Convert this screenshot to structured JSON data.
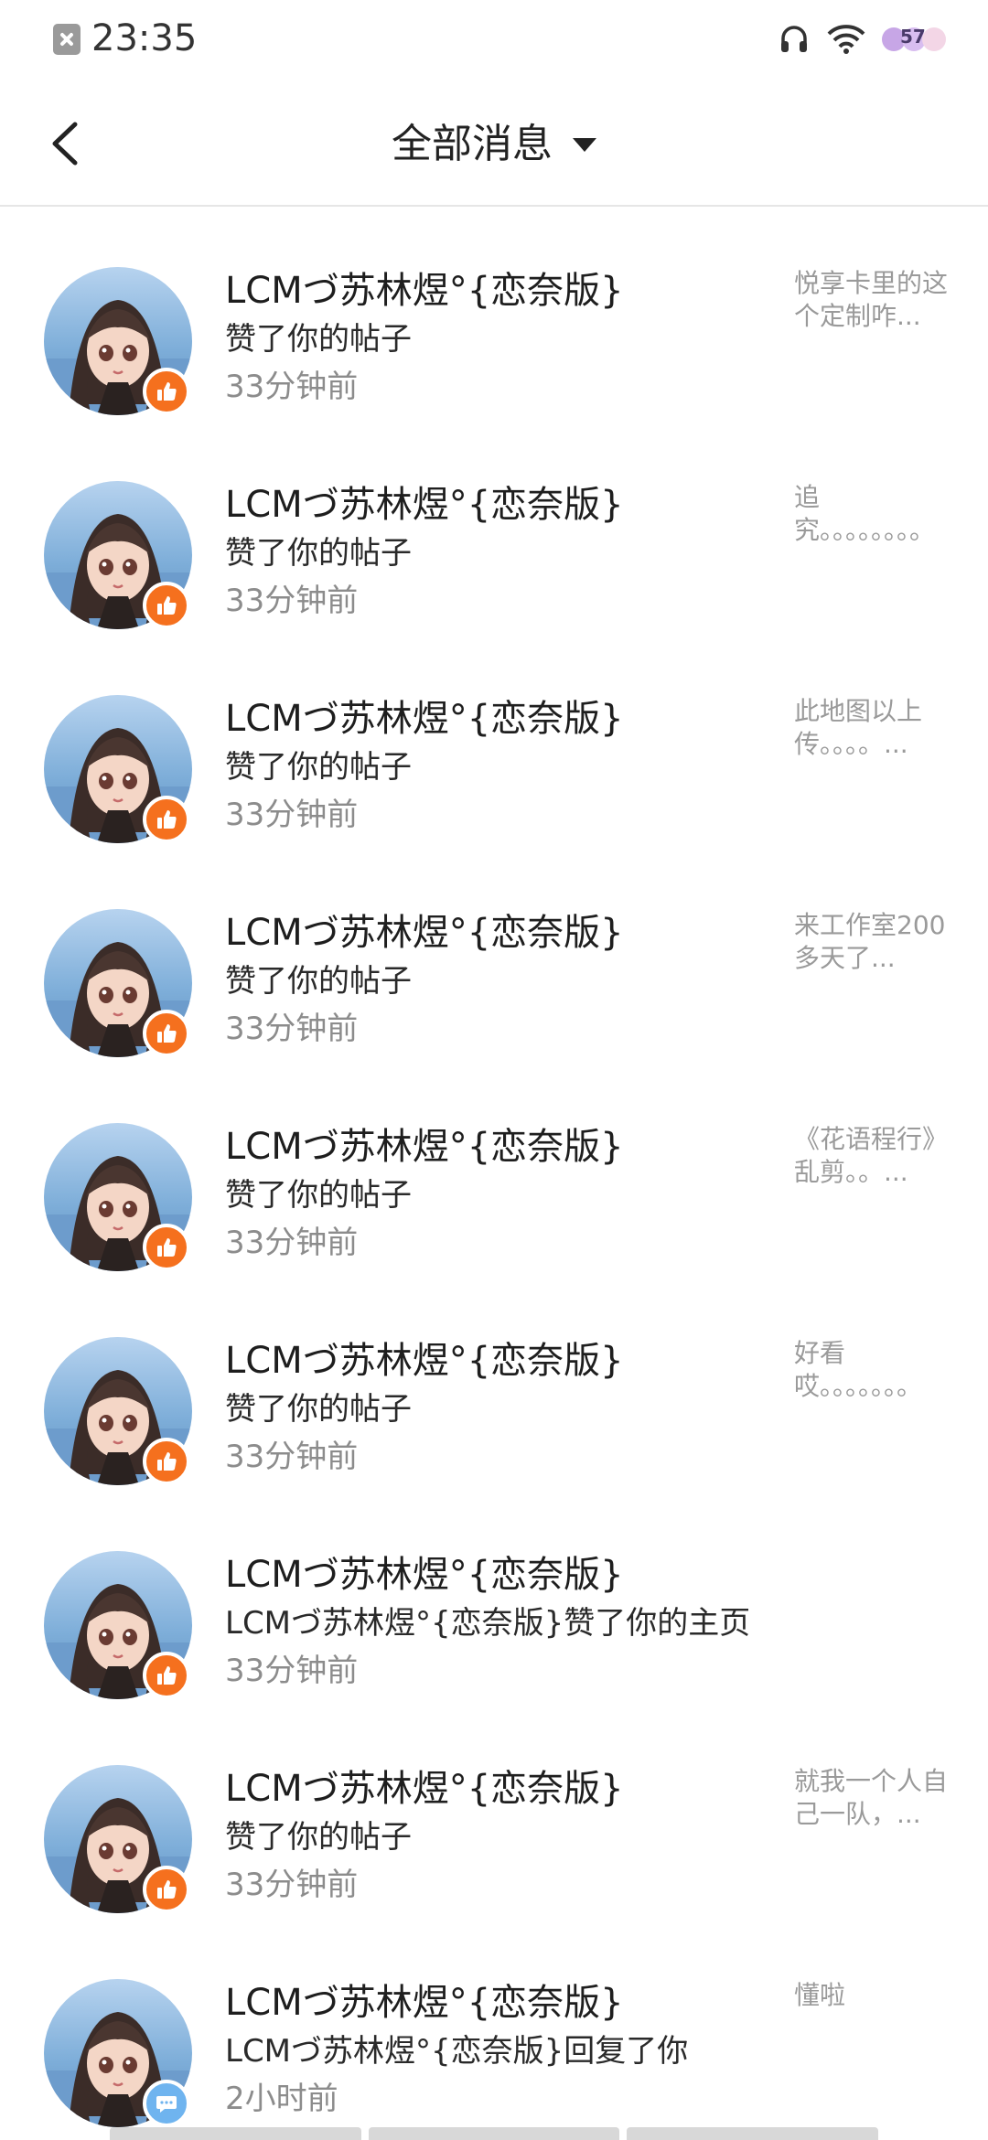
{
  "status_bar": {
    "time": "23:35",
    "battery": "57"
  },
  "header": {
    "title": "全部消息"
  },
  "messages": [
    {
      "name": "LCMづ苏林煜°{恋奈版}",
      "action": "赞了你的帖子",
      "time": "33分钟前",
      "preview": "悦享卡里的这个定制咋...",
      "type": "like"
    },
    {
      "name": "LCMづ苏林煜°{恋奈版}",
      "action": "赞了你的帖子",
      "time": "33分钟前",
      "preview": "追究。。。。。。。。",
      "type": "like"
    },
    {
      "name": "LCMづ苏林煜°{恋奈版}",
      "action": "赞了你的帖子",
      "time": "33分钟前",
      "preview": "此地图以上传。。。。...",
      "type": "like"
    },
    {
      "name": "LCMづ苏林煜°{恋奈版}",
      "action": "赞了你的帖子",
      "time": "33分钟前",
      "preview": "来工作室200多天了...",
      "type": "like"
    },
    {
      "name": "LCMづ苏林煜°{恋奈版}",
      "action": "赞了你的帖子",
      "time": "33分钟前",
      "preview": "《花语程行》乱剪。。...",
      "type": "like"
    },
    {
      "name": "LCMづ苏林煜°{恋奈版}",
      "action": "赞了你的帖子",
      "time": "33分钟前",
      "preview": "好看哎。。。。。。。",
      "type": "like"
    },
    {
      "name": "LCMづ苏林煜°{恋奈版}",
      "action": "LCMづ苏林煜°{恋奈版}赞了你的主页",
      "time": "33分钟前",
      "preview": "",
      "type": "like"
    },
    {
      "name": "LCMづ苏林煜°{恋奈版}",
      "action": "赞了你的帖子",
      "time": "33分钟前",
      "preview": "就我一个人自己一队，...",
      "type": "like"
    },
    {
      "name": "LCMづ苏林煜°{恋奈版}",
      "action": "LCMづ苏林煜°{恋奈版}回复了你",
      "time": "2小时前",
      "preview": "懂啦",
      "type": "reply"
    }
  ]
}
